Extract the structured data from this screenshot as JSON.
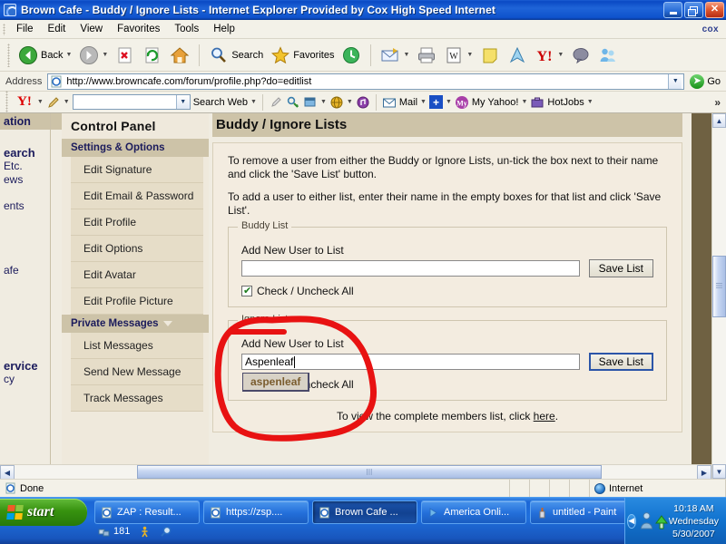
{
  "window": {
    "title": "Brown Cafe - Buddy / Ignore Lists - Internet Explorer Provided by Cox High Speed Internet",
    "icon": "ie-icon",
    "minimize_label": "Minimize",
    "restore_label": "Restore",
    "close_label": "Close"
  },
  "menubar": {
    "items": [
      "File",
      "Edit",
      "View",
      "Favorites",
      "Tools",
      "Help"
    ],
    "brand": "cox"
  },
  "toolbar": {
    "back_label": "Back",
    "forward_label": "Forward",
    "stop_label": "Stop",
    "refresh_label": "Refresh",
    "home_label": "Home",
    "search_label": "Search",
    "favorites_label": "Favorites",
    "history_label": "History",
    "mail_label": "Mail",
    "print_label": "Print",
    "edit_label": "Edit",
    "notes_label": "Notes",
    "messenger_label": "Messenger",
    "yahoo_label": "Yahoo",
    "discuss_label": "Discuss",
    "people_label": "People"
  },
  "address": {
    "label": "Address",
    "url": "http://www.browncafe.com/forum/profile.php?do=editlist",
    "go_label": "Go"
  },
  "yahoo_toolbar": {
    "logo": "Y!",
    "search_value": "",
    "search_web_label": "Search Web",
    "mail_label": "Mail",
    "my_yahoo_label": "My Yahoo!",
    "hotjobs_label": "HotJobs",
    "overflow_label": "»"
  },
  "left_column": {
    "header": "ation",
    "lines": [
      "earch",
      " Etc.",
      "ews",
      "",
      "ents",
      "",
      "",
      "",
      "afe",
      "",
      "",
      "ervice",
      "cy"
    ]
  },
  "control_panel": {
    "title": "Control Panel",
    "sections": [
      {
        "label": "Settings & Options",
        "has_arrow": false,
        "items": [
          "Edit Signature",
          "Edit Email & Password",
          "Edit Profile",
          "Edit Options",
          "Edit Avatar",
          "Edit Profile Picture"
        ]
      },
      {
        "label": "Private Messages",
        "has_arrow": true,
        "items": [
          "List Messages",
          "Send New Message",
          "Track Messages"
        ]
      }
    ]
  },
  "main": {
    "heading": "Buddy / Ignore Lists",
    "paragraph1": "To remove a user from either the Buddy or Ignore Lists, un-tick the box next to their name and click the 'Save List' button.",
    "paragraph2": "To add a user to either list, enter their name in the empty boxes for that list and click 'Save List'.",
    "buddy_list": {
      "legend": "Buddy List",
      "field_label": "Add New User to List",
      "field_value": "",
      "save_label": "Save List",
      "check_all_label": "Check / Uncheck All",
      "check_all_checked": true
    },
    "ignore_list": {
      "legend": "Ignore List",
      "field_label": "Add New User to List",
      "field_value": "Aspenleaf",
      "save_label": "Save List",
      "check_all_label": "Check / Uncheck All",
      "autocomplete_suggestion": "aspenleaf"
    },
    "footnote_prefix": "To view the complete members list, click ",
    "footnote_link": "here",
    "footnote_suffix": "."
  },
  "status_bar": {
    "text": "Done",
    "zone": "Internet"
  },
  "taskbar": {
    "start_label": "start",
    "tasks": [
      {
        "label": "ZAP : Result...",
        "active": false,
        "icon": "ie-icon"
      },
      {
        "label": "https://zsp....",
        "active": false,
        "icon": "ie-icon"
      },
      {
        "label": "Brown Cafe ...",
        "active": true,
        "icon": "ie-icon"
      },
      {
        "label": "America Onli...",
        "active": false,
        "icon": "aol-icon"
      },
      {
        "label": "untitled - Paint",
        "active": false,
        "icon": "paint-icon"
      }
    ],
    "quick_launch_count": "181",
    "clock_time": "10:18 AM",
    "clock_day": "Wednesday",
    "clock_date": "5/30/2007"
  },
  "colors": {
    "title_blue": "#1f64d8",
    "taskbar_blue": "#1f6fdd",
    "page_tan": "#cdc3a8",
    "page_cream": "#f0ece1",
    "annotation_red": "#e81212",
    "brown_margin": "#6f6142"
  }
}
